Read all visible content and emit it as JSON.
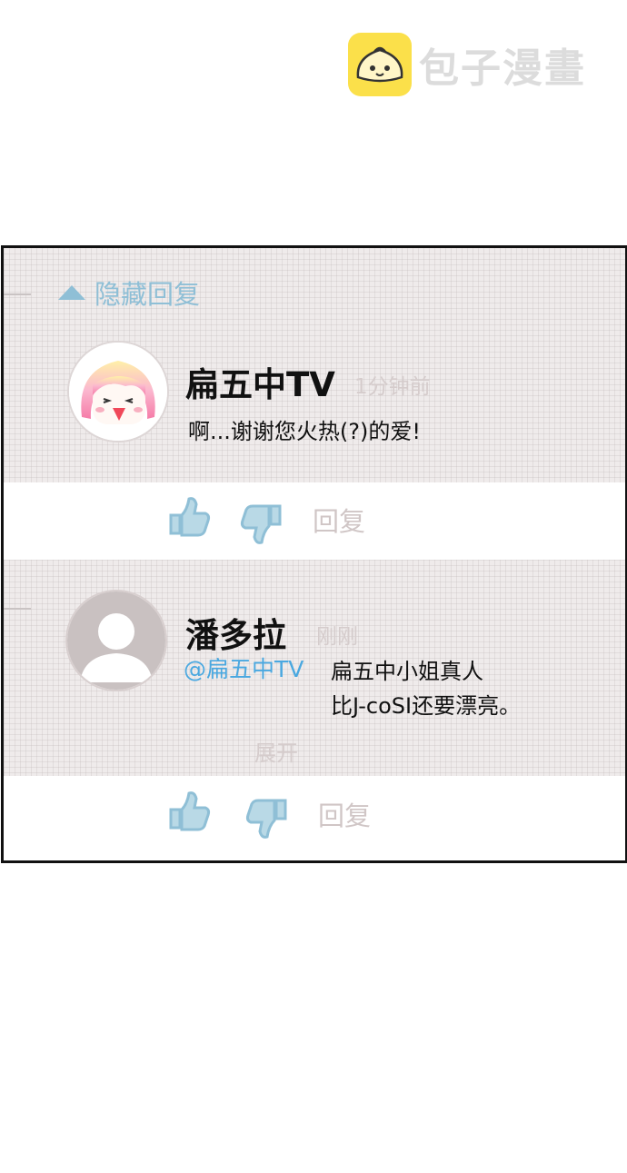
{
  "watermark": {
    "text": "包子漫畫"
  },
  "panel": {
    "hide_replies_label": "隐藏回复",
    "comments": [
      {
        "author": "扁五中TV",
        "time": "1分钟前",
        "message": "啊...谢谢您火热(?)的爱!",
        "reply_label": "回复"
      },
      {
        "author": "潘多拉",
        "time": "刚刚",
        "mention": "@扁五中TV",
        "message_line1": "扁五中小姐真人",
        "message_line2": "比J-coSI还要漂亮。",
        "expand_label": "展开",
        "reply_label": "回复"
      }
    ]
  },
  "colors": {
    "accent_blue": "#8fbfd6",
    "mention_blue": "#4aa8e0",
    "muted_text": "#d0c6c6",
    "grid_bg": "#efebeb"
  },
  "icons": [
    "thumbs-up-icon",
    "thumbs-down-icon",
    "caret-up-icon"
  ]
}
